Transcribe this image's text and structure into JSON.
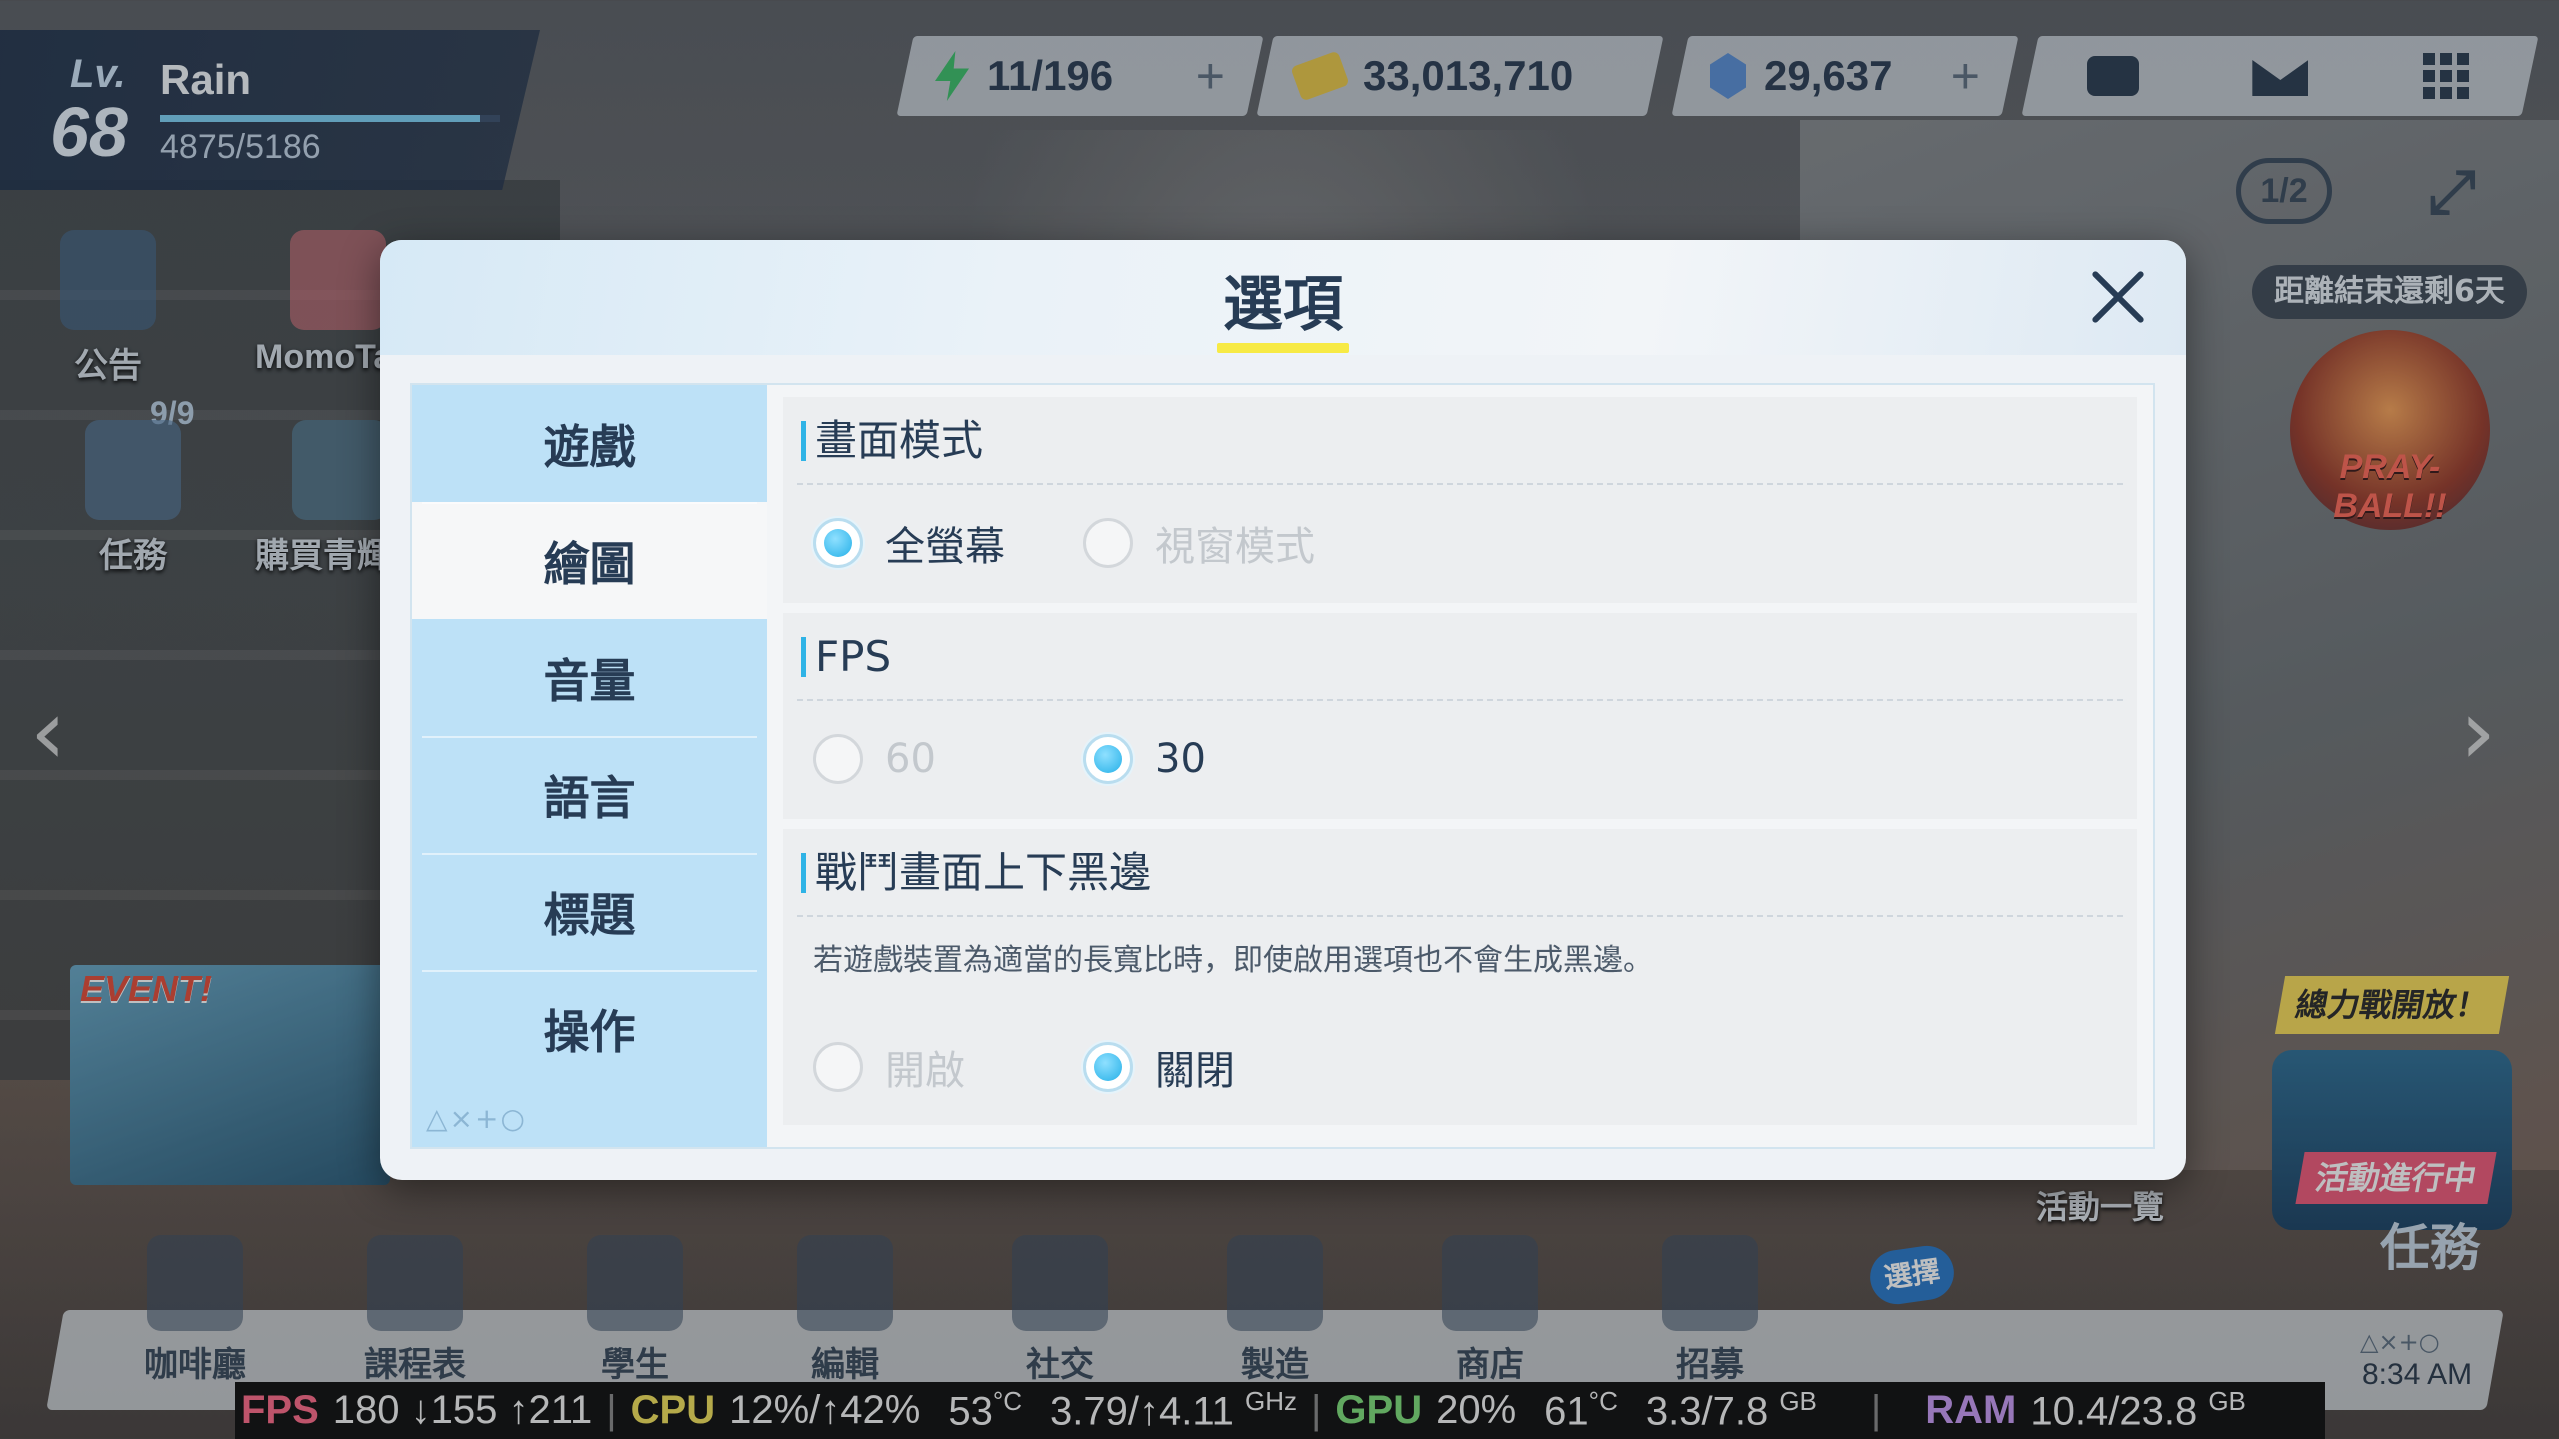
{
  "player": {
    "lv_label": "Lv.",
    "level": "68",
    "name": "Rain",
    "exp_text": "4875/5186",
    "exp_fraction": 0.94
  },
  "resources": {
    "ap": "11/196",
    "credits": "33,013,710",
    "gems": "29,637",
    "plus": "+"
  },
  "top_right": {
    "page_indicator": "1/2",
    "expand_icon": "expand-icon"
  },
  "left_side": {
    "notice": "公告",
    "momotalk": "MomoTalk",
    "task_count": "9/9",
    "task": "任務",
    "purchase": "購買青輝石",
    "event_banner": "EVENT!"
  },
  "right_side": {
    "countdown": "距離結束還剩6天",
    "banner_text": "PRAY-BALL!!",
    "event_open": "總力戰開放！",
    "event_live": "活動進行中",
    "event_task": "任務",
    "event_list": "活動一覽"
  },
  "dock": [
    {
      "label": "咖啡廳"
    },
    {
      "label": "課程表"
    },
    {
      "label": "學生"
    },
    {
      "label": "編輯"
    },
    {
      "label": "社交"
    },
    {
      "label": "製造"
    },
    {
      "label": "商店"
    },
    {
      "label": "招募"
    }
  ],
  "recruit_badge": "選擇",
  "clock": "8:34 AM",
  "clock_icons": "△×+○",
  "dialog": {
    "title": "選項",
    "tabs": [
      "遊戲",
      "繪圖",
      "音量",
      "語言",
      "標題",
      "操作"
    ],
    "active_tab": "繪圖",
    "tab_deco": "△×+○",
    "sections": {
      "screen_mode": {
        "title": "畫面模式",
        "options": [
          "全螢幕",
          "視窗模式"
        ],
        "selected": "全螢幕"
      },
      "fps": {
        "title": "FPS",
        "options": [
          "60",
          "30"
        ],
        "selected": "30"
      },
      "letterbox": {
        "title": "戰鬥畫面上下黑邊",
        "description": "若遊戲裝置為適當的長寬比時，即使啟用選項也不會生成黑邊。",
        "options": [
          "開啟",
          "關閉"
        ],
        "selected": "關閉"
      }
    }
  },
  "perf": {
    "fps_label": "FPS",
    "fps_value": "180 ↓155 ↑211",
    "cpu_label": "CPU",
    "cpu_value": "12%/↑42%",
    "cpu_temp": "53",
    "temp_unit": "°C",
    "cpu_freq": "3.79/↑4.11",
    "ghz": "GHz",
    "gpu_label": "GPU",
    "gpu_value": "20%",
    "gpu_temp": "61",
    "vram": "3.3/7.8",
    "gb": "GB",
    "ram_label": "RAM",
    "ram_value": "10.4/23.8"
  },
  "colors": {
    "accent": "#2fb3e6",
    "title_underline": "#f7ea45",
    "tab_bg": "#bde1f7",
    "text_dark": "#273c55"
  }
}
